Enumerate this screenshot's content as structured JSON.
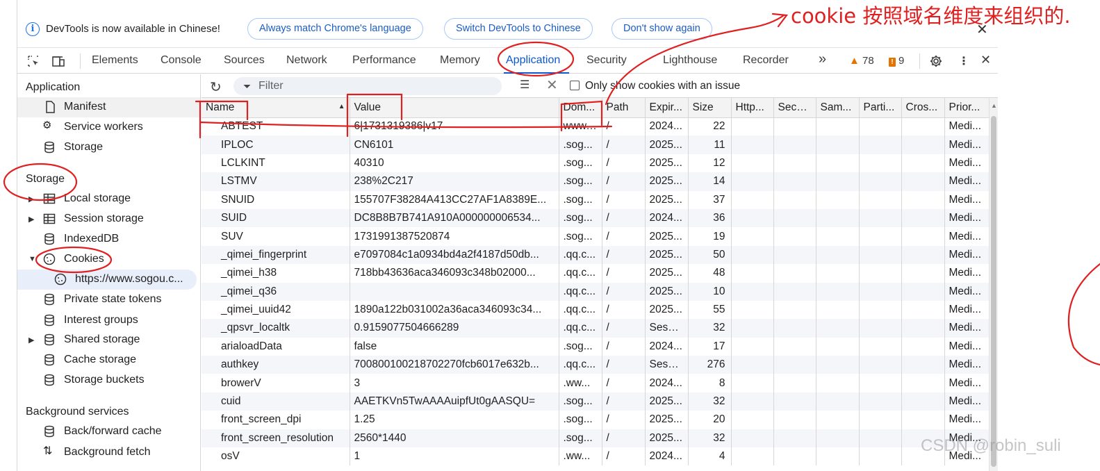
{
  "infobar": {
    "text": "DevTools is now available in Chinese!",
    "btn_match": "Always match Chrome's language",
    "btn_switch": "Switch DevTools to Chinese",
    "btn_dont_show": "Don't show again"
  },
  "tabs": {
    "elements": "Elements",
    "console": "Console",
    "sources": "Sources",
    "network": "Network",
    "performance": "Performance",
    "memory": "Memory",
    "application": "Application",
    "security": "Security",
    "lighthouse": "Lighthouse",
    "recorder": "Recorder",
    "more": "»",
    "warnings": "78",
    "errors": "9"
  },
  "sidebar": {
    "application_header": "Application",
    "manifest": "Manifest",
    "service_workers": "Service workers",
    "storage_item": "Storage",
    "storage_header": "Storage",
    "local_storage": "Local storage",
    "session_storage": "Session storage",
    "indexeddb": "IndexedDB",
    "cookies": "Cookies",
    "cookie_origin": "https://www.sogou.c...",
    "private_state_tokens": "Private state tokens",
    "interest_groups": "Interest groups",
    "shared_storage": "Shared storage",
    "cache_storage": "Cache storage",
    "storage_buckets": "Storage buckets",
    "bg_header": "Background services",
    "bfcache": "Back/forward cache",
    "bg_fetch": "Background fetch"
  },
  "toolbar": {
    "filter_placeholder": "Filter",
    "only_issue_label": "Only show cookies with an issue"
  },
  "table": {
    "headers": [
      "Name",
      "Value",
      "Dom...",
      "Path",
      "Expir...",
      "Size",
      "Http...",
      "Secu...",
      "Sam...",
      "Parti...",
      "Cros...",
      "Prior..."
    ],
    "rows": [
      [
        "ABTEST",
        "6|1731319386|v17",
        "www....",
        "/",
        "2024...",
        "22",
        "",
        "",
        "",
        "",
        "",
        "Medi..."
      ],
      [
        "IPLOC",
        "CN6101",
        ".sog...",
        "/",
        "2025...",
        "11",
        "",
        "",
        "",
        "",
        "",
        "Medi..."
      ],
      [
        "LCLKINT",
        "40310",
        ".sog...",
        "/",
        "2025...",
        "12",
        "",
        "",
        "",
        "",
        "",
        "Medi..."
      ],
      [
        "LSTMV",
        "238%2C217",
        ".sog...",
        "/",
        "2025...",
        "14",
        "",
        "",
        "",
        "",
        "",
        "Medi..."
      ],
      [
        "SNUID",
        "155707F38284A413CC27AF1A8389E...",
        ".sog...",
        "/",
        "2025...",
        "37",
        "",
        "",
        "",
        "",
        "",
        "Medi..."
      ],
      [
        "SUID",
        "DC8B8B7B741A910A000000006534...",
        ".sog...",
        "/",
        "2024...",
        "36",
        "",
        "",
        "",
        "",
        "",
        "Medi..."
      ],
      [
        "SUV",
        "1731991387520874",
        ".sog...",
        "/",
        "2025...",
        "19",
        "",
        "",
        "",
        "",
        "",
        "Medi..."
      ],
      [
        "_qimei_fingerprint",
        "e7097084c1a0934bd4a2f4187d50db...",
        ".qq.c...",
        "/",
        "2025...",
        "50",
        "",
        "",
        "",
        "",
        "",
        "Medi..."
      ],
      [
        "_qimei_h38",
        "718bb43636aca346093c348b02000...",
        ".qq.c...",
        "/",
        "2025...",
        "48",
        "",
        "",
        "",
        "",
        "",
        "Medi..."
      ],
      [
        "_qimei_q36",
        "",
        ".qq.c...",
        "/",
        "2025...",
        "10",
        "",
        "",
        "",
        "",
        "",
        "Medi..."
      ],
      [
        "_qimei_uuid42",
        "1890a122b031002a36aca346093c34...",
        ".qq.c...",
        "/",
        "2025...",
        "55",
        "",
        "",
        "",
        "",
        "",
        "Medi..."
      ],
      [
        "_qpsvr_localtk",
        "0.9159077504666289",
        ".qq.c...",
        "/",
        "Sessi...",
        "32",
        "",
        "",
        "",
        "",
        "",
        "Medi..."
      ],
      [
        "arialoadData",
        "false",
        ".sog...",
        "/",
        "2024...",
        "17",
        "",
        "",
        "",
        "",
        "",
        "Medi..."
      ],
      [
        "authkey",
        "700800100218702270fcb6017e632b...",
        ".qq.c...",
        "/",
        "Sessi...",
        "276",
        "",
        "",
        "",
        "",
        "",
        "Medi..."
      ],
      [
        "browerV",
        "3",
        ".ww...",
        "/",
        "2024...",
        "8",
        "",
        "",
        "",
        "",
        "",
        "Medi..."
      ],
      [
        "cuid",
        "AAETKVn5TwAAAAuipfUt0gAASQU=",
        ".sog...",
        "/",
        "2025...",
        "32",
        "",
        "",
        "",
        "",
        "",
        "Medi..."
      ],
      [
        "front_screen_dpi",
        "1.25",
        ".sog...",
        "/",
        "2025...",
        "20",
        "",
        "",
        "",
        "",
        "",
        "Medi..."
      ],
      [
        "front_screen_resolution",
        "2560*1440",
        ".sog...",
        "/",
        "2025...",
        "32",
        "",
        "",
        "",
        "",
        "",
        "Medi..."
      ],
      [
        "osV",
        "1",
        ".ww...",
        "/",
        "2024...",
        "4",
        "",
        "",
        "",
        "",
        "",
        "Medi..."
      ]
    ]
  },
  "annotation": {
    "text": "cookie 按照域名维度来组织的."
  },
  "watermark": "CSDN @robin_suli",
  "colors": {
    "accent": "#0b57d0",
    "annotation": "#e02020",
    "warning": "#e37400"
  }
}
